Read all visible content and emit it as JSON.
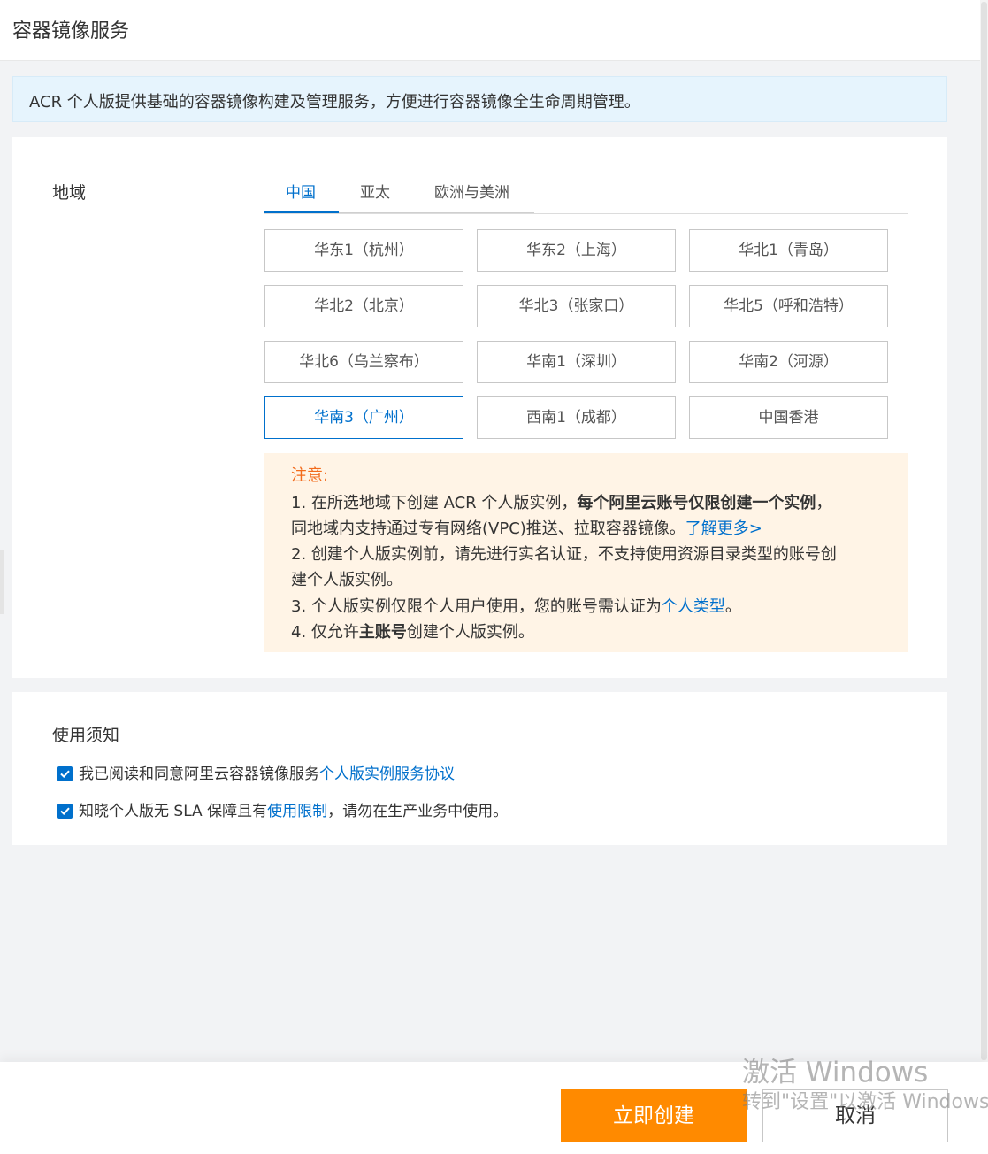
{
  "header": {
    "title": "容器镜像服务"
  },
  "info_banner": {
    "text": "ACR 个人版提供基础的容器镜像构建及管理服务，方便进行容器镜像全生命周期管理。"
  },
  "region": {
    "label": "地域",
    "tabs": [
      "中国",
      "亚太",
      "欧洲与美洲"
    ],
    "active_tab": "中国",
    "options": [
      "华东1（杭州）",
      "华东2（上海）",
      "华北1（青岛）",
      "华北2（北京）",
      "华北3（张家口）",
      "华北5（呼和浩特）",
      "华北6（乌兰察布）",
      "华南1（深圳）",
      "华南2（河源）",
      "华南3（广州）",
      "西南1（成都）",
      "中国香港"
    ],
    "selected": "华南3（广州）"
  },
  "warning": {
    "title": "注意:",
    "l1_a": "1. 在所选地域下创建 ACR 个人版实例，",
    "l1_b": "每个阿里云账号仅限创建一个实例",
    "l1_c": "，",
    "l2_a": "同地域内支持通过专有网络(VPC)推送、拉取容器镜像。",
    "l2_link": "了解更多>",
    "l3": "2. 创建个人版实例前，请先进行实名认证，不支持使用资源目录类型的账号创",
    "l4": "建个人版实例。",
    "l5_a": "3. 个人版实例仅限个人用户使用，您的账号需认证为",
    "l5_link": "个人类型",
    "l5_c": "。",
    "l6_a": "4. 仅允许",
    "l6_b": "主账号",
    "l6_c": "创建个人版实例。"
  },
  "notice": {
    "title": "使用须知",
    "item1_text": "我已阅读和同意阿里云容器镜像服务",
    "item1_link": "个人版实例服务协议",
    "item1_checked": true,
    "item2_text": "知晓个人版无 SLA 保障且有",
    "item2_link": "使用限制",
    "item2_tail": "，请勿在生产业务中使用。",
    "item2_checked": true
  },
  "footer": {
    "create_label": "立即创建",
    "cancel_label": "取消"
  },
  "watermark": {
    "line1": "激活 Windows",
    "line2": "转到\"设置\"以激活 Windows。"
  },
  "colors": {
    "accent": "#0070cc",
    "primary_button": "#ff8a00",
    "warning_title": "#f26b1c",
    "warning_bg": "#fff4e6",
    "info_bg": "#e6f4fd"
  }
}
